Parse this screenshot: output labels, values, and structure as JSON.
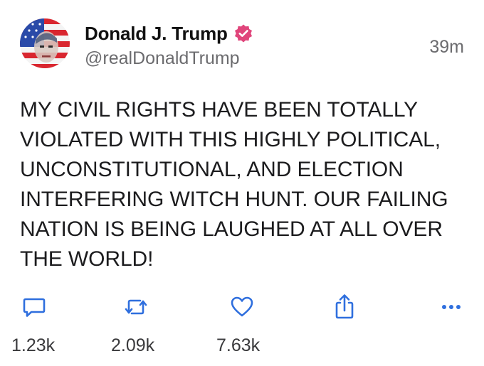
{
  "author": {
    "display_name": "Donald J. Trump",
    "handle": "@realDonaldTrump",
    "verified": true
  },
  "post": {
    "timestamp": "39m",
    "text": "MY CIVIL RIGHTS HAVE BEEN TOTALLY VIOLATED WITH THIS HIGHLY POLITICAL, UNCONSTITUTIONAL, AND ELECTION INTERFERING WITCH HUNT. OUR FAILING NATION IS BEING LAUGHED AT ALL OVER THE WORLD!"
  },
  "actions": {
    "reply_count": "1.23k",
    "repost_count": "2.09k",
    "like_count": "7.63k"
  },
  "icons": {
    "reply": "reply-icon",
    "repost": "repost-icon",
    "like": "heart-icon",
    "share": "share-icon",
    "more": "more-icon",
    "verified": "verified-badge-icon"
  },
  "colors": {
    "verified_badge": "#e0457b",
    "icon_blue": "#2f6fde",
    "text": "#1c1c1e",
    "muted": "#6b6b6e"
  }
}
